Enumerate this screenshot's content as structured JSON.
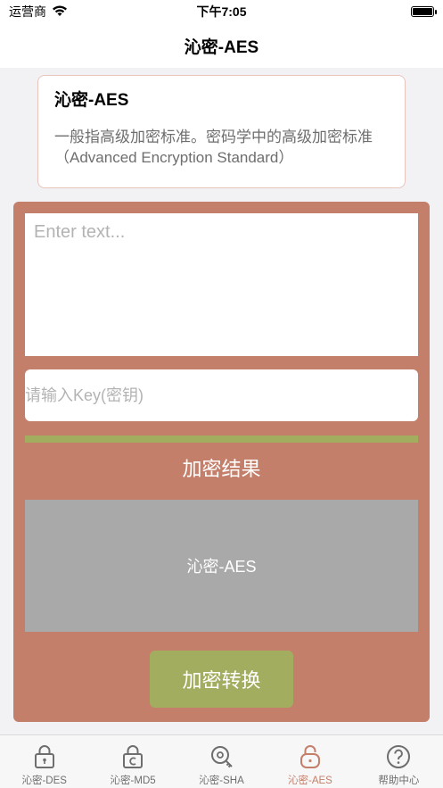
{
  "status_bar": {
    "carrier": "运营商",
    "time": "下午7:05"
  },
  "nav": {
    "title": "沁密-AES"
  },
  "info_card": {
    "title": "沁密-AES",
    "description": "一般指高级加密标准。密码学中的高级加密标准（Advanced Encryption Standard）"
  },
  "panel": {
    "text_placeholder": "Enter text...",
    "key_placeholder": "请输入Key(密钥)",
    "result_label": "加密结果",
    "result_value": "沁密-AES",
    "convert_button": "加密转换"
  },
  "tabs": [
    {
      "label": "沁密-DES",
      "icon": "lock-icon"
    },
    {
      "label": "沁密-MD5",
      "icon": "lock-c-icon"
    },
    {
      "label": "沁密-SHA",
      "icon": "key-icon"
    },
    {
      "label": "沁密-AES",
      "icon": "unlock-icon",
      "active": true
    },
    {
      "label": "帮助中心",
      "icon": "help-icon"
    }
  ],
  "colors": {
    "panel": "#c47f6b",
    "accent": "#a3ad5f",
    "result_box": "#a9a9a9"
  }
}
